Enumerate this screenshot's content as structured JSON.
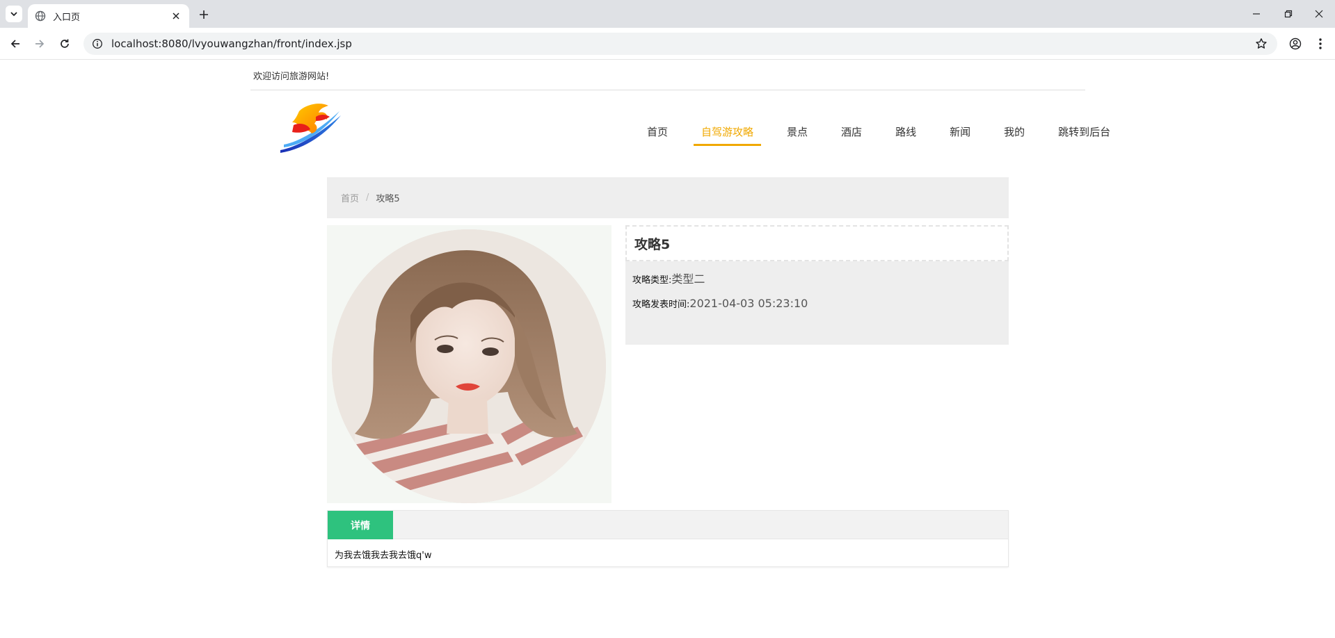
{
  "browser": {
    "tab_title": "入口页",
    "url": "localhost:8080/lvyouwangzhan/front/index.jsp"
  },
  "header": {
    "welcome": "欢迎访问旅游网站!"
  },
  "nav": {
    "items": [
      {
        "label": "首页"
      },
      {
        "label": "自驾游攻略"
      },
      {
        "label": "景点"
      },
      {
        "label": "酒店"
      },
      {
        "label": "路线"
      },
      {
        "label": "新闻"
      },
      {
        "label": "我的"
      },
      {
        "label": "跳转到后台"
      }
    ],
    "active_index": 1,
    "accent_color": "#f0a800"
  },
  "breadcrumb": {
    "home": "首页",
    "separator": "/",
    "current": "攻略5"
  },
  "article": {
    "title": "攻略5",
    "type_label": "攻略类型:",
    "type_value": "类型二",
    "time_label": "攻略发表时间:",
    "time_value": "2021-04-03 05:23:10"
  },
  "detail": {
    "tab_label": "详情",
    "tab_color": "#2ec27e",
    "content": "为我去饿我去我去饿q'w"
  }
}
